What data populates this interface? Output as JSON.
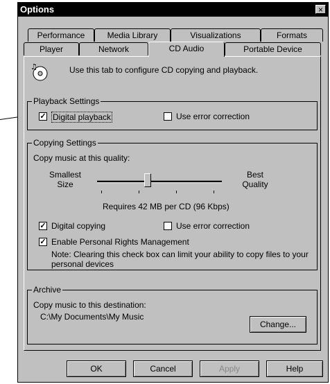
{
  "window": {
    "title": "Options",
    "close_glyph": "×"
  },
  "tabs_row1": [
    "Performance",
    "Media Library",
    "Visualizations",
    "Formats"
  ],
  "tabs_row2": [
    "Player",
    "Network",
    "CD Audio",
    "Portable Device"
  ],
  "active_tab": "CD Audio",
  "header": {
    "icon": "cd-music-icon",
    "description": "Use this tab to configure CD copying and playback."
  },
  "playback": {
    "legend": "Playback Settings",
    "digital_playback": {
      "label": "Digital playback",
      "checked": true
    },
    "error_correction": {
      "label": "Use error correction",
      "checked": false
    }
  },
  "copying": {
    "legend": "Copying Settings",
    "quality_label": "Copy music at this quality:",
    "slider_left": "Smallest Size",
    "slider_right": "Best Quality",
    "slider_position": 0.4,
    "requires": "Requires 42 MB per CD (96 Kbps)",
    "digital_copying": {
      "label": "Digital copying",
      "checked": true
    },
    "error_correction": {
      "label": "Use error correction",
      "checked": false
    },
    "prm": {
      "label": "Enable Personal Rights Management",
      "checked": true
    },
    "note": "Note: Clearing this check box can limit your ability to copy files to your personal devices"
  },
  "archive": {
    "legend": "Archive",
    "dest_label": "Copy music to this destination:",
    "path": "C:\\My Documents\\My Music",
    "change": "Change..."
  },
  "buttons": {
    "ok": "OK",
    "cancel": "Cancel",
    "apply": "Apply",
    "help": "Help"
  },
  "check_glyph": "✓"
}
